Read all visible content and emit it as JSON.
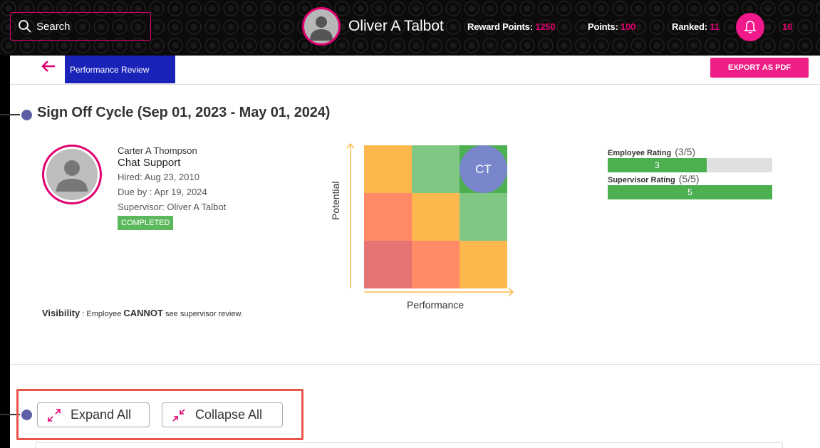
{
  "header": {
    "search_label": "Search",
    "user_name": "Oliver A Talbot",
    "reward_points_label": "Reward Points:",
    "reward_points_value": "1250",
    "points_label": "Points:",
    "points_value": "100",
    "ranked_label": "Ranked:",
    "ranked_value": "11",
    "notification_count": "16"
  },
  "breadcrumb": {
    "current": "Performance Review"
  },
  "actions": {
    "export_label": "EXPORT AS PDF"
  },
  "review": {
    "cycle_title": "Sign Off Cycle (Sep 01, 2023 - May 01, 2024)",
    "employee": {
      "name": "Carter A Thompson",
      "role": "Chat Support",
      "hired": "Hired: Aug 23, 2010",
      "due": "Due by : Apr 19, 2024",
      "supervisor": "Supervisor: Oliver A Talbot",
      "status": "COMPLETED"
    },
    "visibility_label": "Visibility",
    "visibility_prefix": " : Employee ",
    "visibility_emphasis": "CANNOT",
    "visibility_suffix": " see supervisor review."
  },
  "matrix": {
    "x_label": "Performance",
    "y_label": "Potential",
    "marker_label": "CT",
    "colors": [
      "#fcb84d",
      "#81c784",
      "#4caf50",
      "#ff8a65",
      "#fcb84d",
      "#81c784",
      "#e57373",
      "#ff8a65",
      "#fcb84d"
    ]
  },
  "ratings": {
    "employee": {
      "label": "Employee Rating",
      "fraction": "(3/5)",
      "value": "3",
      "score": 3,
      "max": 5
    },
    "supervisor": {
      "label": "Supervisor Rating",
      "fraction": "(5/5)",
      "value": "5",
      "score": 5,
      "max": 5
    }
  },
  "controls": {
    "expand_label": "Expand All",
    "collapse_label": "Collapse All"
  },
  "colors": {
    "accent": "#e0006f",
    "breadcrumb_bg": "#1a23b8",
    "rating_fill": "#4caf50",
    "highlight": "#e8544a"
  }
}
